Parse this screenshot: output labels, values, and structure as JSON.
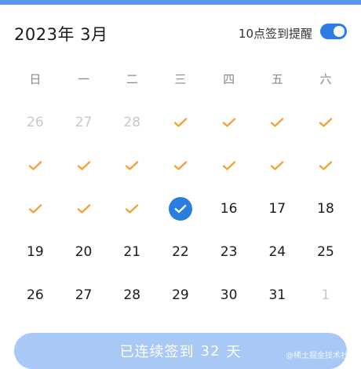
{
  "header": {
    "title": "2023年 3月",
    "reminder_label": "10点签到提醒",
    "reminder_enabled": true
  },
  "weekdays": [
    "日",
    "一",
    "二",
    "三",
    "四",
    "五",
    "六"
  ],
  "calendar": {
    "rows": [
      [
        {
          "label": "26",
          "state": "other"
        },
        {
          "label": "27",
          "state": "other"
        },
        {
          "label": "28",
          "state": "other"
        },
        {
          "label": "",
          "state": "checked"
        },
        {
          "label": "",
          "state": "checked"
        },
        {
          "label": "",
          "state": "checked"
        },
        {
          "label": "",
          "state": "checked"
        }
      ],
      [
        {
          "label": "",
          "state": "checked"
        },
        {
          "label": "",
          "state": "checked"
        },
        {
          "label": "",
          "state": "checked"
        },
        {
          "label": "",
          "state": "checked"
        },
        {
          "label": "",
          "state": "checked"
        },
        {
          "label": "",
          "state": "checked"
        },
        {
          "label": "",
          "state": "checked"
        }
      ],
      [
        {
          "label": "",
          "state": "checked"
        },
        {
          "label": "",
          "state": "checked"
        },
        {
          "label": "",
          "state": "checked"
        },
        {
          "label": "",
          "state": "today-checked"
        },
        {
          "label": "16",
          "state": "normal"
        },
        {
          "label": "17",
          "state": "normal"
        },
        {
          "label": "18",
          "state": "normal"
        }
      ],
      [
        {
          "label": "19",
          "state": "normal"
        },
        {
          "label": "20",
          "state": "normal"
        },
        {
          "label": "21",
          "state": "normal"
        },
        {
          "label": "22",
          "state": "normal"
        },
        {
          "label": "23",
          "state": "normal"
        },
        {
          "label": "24",
          "state": "normal"
        },
        {
          "label": "25",
          "state": "normal"
        }
      ],
      [
        {
          "label": "26",
          "state": "normal"
        },
        {
          "label": "27",
          "state": "normal"
        },
        {
          "label": "28",
          "state": "normal"
        },
        {
          "label": "29",
          "state": "normal"
        },
        {
          "label": "30",
          "state": "normal"
        },
        {
          "label": "31",
          "state": "normal"
        },
        {
          "label": "1",
          "state": "other"
        }
      ]
    ]
  },
  "footer": {
    "prefix": "已连续签到",
    "days": "32",
    "suffix": "天"
  },
  "watermark": "@稀土掘金技术社区",
  "colors": {
    "accent": "#2a7de1",
    "check": "#f2a43a",
    "button": "#a8c8f6"
  },
  "icons": {
    "checked": "checkmark-icon",
    "today": "checkmark-circle-icon"
  }
}
